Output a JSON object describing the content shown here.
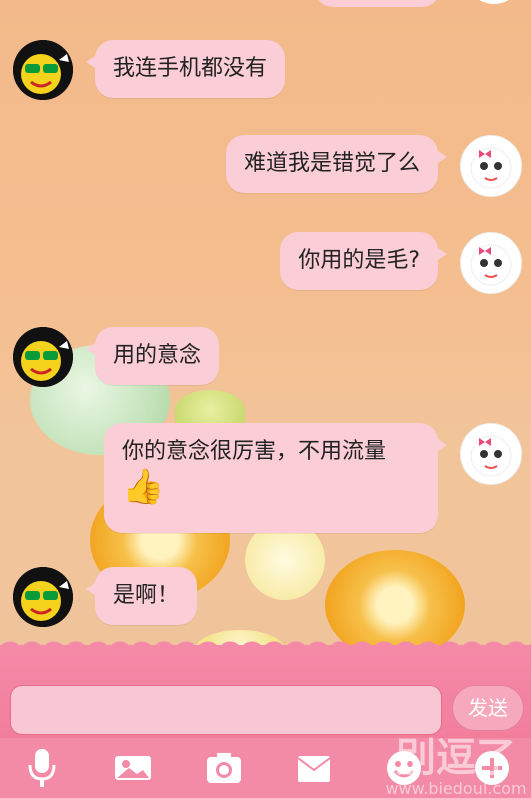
{
  "messages": [
    {
      "side": "left",
      "text": "我连手机都没有",
      "avatar": "boy-sunglasses-avatar"
    },
    {
      "side": "right",
      "text": "难道我是错觉了么",
      "avatar": "girl-avatar"
    },
    {
      "side": "right",
      "text": "你用的是毛?",
      "avatar": "girl-avatar"
    },
    {
      "side": "left",
      "text": "用的意念",
      "avatar": "boy-sunglasses-avatar"
    },
    {
      "side": "right",
      "text": "你的意念很厉害，不用流量",
      "emoji": "👍",
      "avatar": "girl-avatar"
    },
    {
      "side": "left",
      "text": "是啊！",
      "avatar": "boy-sunglasses-avatar"
    }
  ],
  "input": {
    "value": "",
    "send_label": "发送"
  },
  "toolbar": [
    "microphone-icon",
    "image-icon",
    "camera-icon",
    "envelope-icon",
    "smiley-icon",
    "plus-icon"
  ],
  "watermark": {
    "main": "别逗了",
    "sub": "www.biedoul.com"
  }
}
